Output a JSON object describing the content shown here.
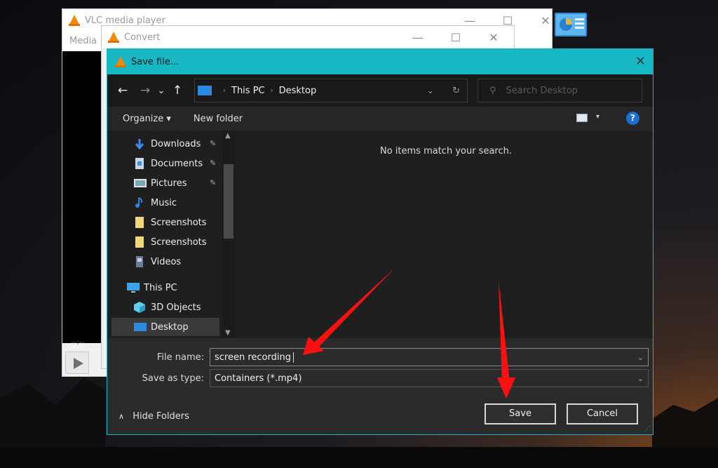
{
  "vlc_window": {
    "title": "VLC media player",
    "menu_items": [
      "Media"
    ],
    "time_display": "--:--",
    "controls": {
      "minimize": "—",
      "maximize": "☐",
      "close": "✕"
    }
  },
  "convert_window": {
    "title": "Convert",
    "controls": {
      "minimize": "—",
      "maximize": "☐",
      "close": "✕"
    }
  },
  "save_dialog": {
    "title": "Save file...",
    "close": "✕",
    "nav": {
      "back": "←",
      "forward": "→",
      "recent": "⌄",
      "up": "↑"
    },
    "address": {
      "crumbs": [
        "This PC",
        "Desktop"
      ],
      "separator": "›",
      "dropdown": "⌄",
      "refresh": "↻"
    },
    "search": {
      "placeholder": "Search Desktop",
      "icon": "⚲"
    },
    "command_bar": {
      "organize": "Organize ▾",
      "new_folder": "New folder",
      "view_caret": "▾",
      "help": "?"
    },
    "nav_pane": {
      "items": [
        {
          "label": "Downloads",
          "icon": "downloads-icon",
          "pinned": true,
          "color": "#3b8ee8"
        },
        {
          "label": "Documents",
          "icon": "documents-icon",
          "pinned": true,
          "color": "#c8d8e8"
        },
        {
          "label": "Pictures",
          "icon": "pictures-icon",
          "pinned": true,
          "color": "#9ab8c8"
        },
        {
          "label": "Music",
          "icon": "music-icon",
          "pinned": false,
          "color": "#2d86e0"
        },
        {
          "label": "Screenshots",
          "icon": "folder-icon",
          "pinned": false,
          "color": "#f2d77a"
        },
        {
          "label": "Screenshots",
          "icon": "folder-icon",
          "pinned": false,
          "color": "#f2d77a"
        },
        {
          "label": "Videos",
          "icon": "videos-icon",
          "pinned": false,
          "color": "#6c7a9a"
        },
        {
          "label": "This PC",
          "icon": "this-pc-icon",
          "pinned": false,
          "color": "#3aa6f0"
        },
        {
          "label": "3D Objects",
          "icon": "3d-objects-icon",
          "pinned": false,
          "color": "#5ed0e8"
        },
        {
          "label": "Desktop",
          "icon": "desktop-icon",
          "pinned": false,
          "color": "#2b8ae0",
          "selected": true
        }
      ],
      "pin_glyph": "📌"
    },
    "content": {
      "empty_message": "No items match your search."
    },
    "file_name": {
      "label": "File name:",
      "value": "screen recording"
    },
    "save_as_type": {
      "label": "Save as type:",
      "value": "Containers (*.mp4)"
    },
    "hide_folders": "Hide Folders",
    "buttons": {
      "save": "Save",
      "cancel": "Cancel"
    }
  },
  "annotation_color": "#ff1010",
  "accent_color": "#17b8c4"
}
